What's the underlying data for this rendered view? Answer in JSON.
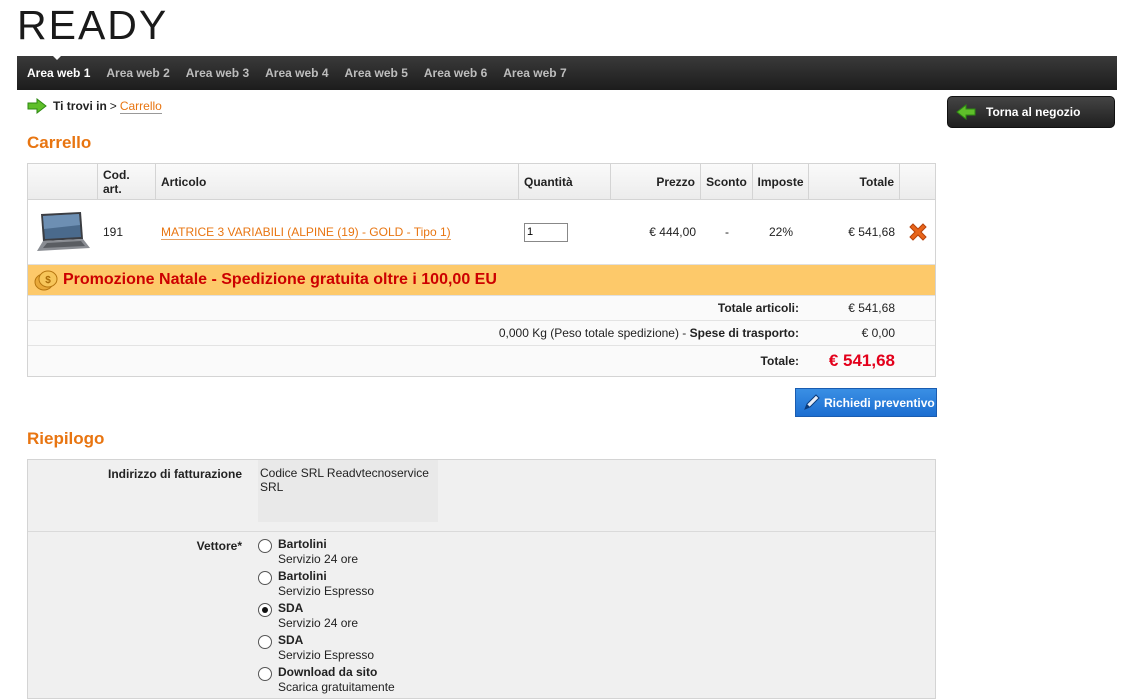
{
  "brand": {
    "logo": "READY"
  },
  "nav": {
    "items": [
      "Area web 1",
      "Area web 2",
      "Area web 3",
      "Area web 4",
      "Area web 5",
      "Area web 6",
      "Area web 7"
    ],
    "active": 0
  },
  "breadcrumb": {
    "prefix": "Ti trovi in",
    "separator": ">",
    "current": "Carrello"
  },
  "back_button": {
    "label": "Torna al negozio"
  },
  "cart": {
    "title": "Carrello",
    "headers": {
      "cod": "Cod. art.",
      "articolo": "Articolo",
      "quantita": "Quantità",
      "prezzo": "Prezzo",
      "sconto": "Sconto",
      "imposte": "Imposte",
      "totale": "Totale"
    },
    "item": {
      "cod": "191",
      "name": "MATRICE 3 VARIABILI (ALPINE (19) - GOLD - Tipo 1)",
      "qty": "1",
      "price": "€ 444,00",
      "discount": "-",
      "tax": "22%",
      "total": "€ 541,68"
    },
    "promo": "Promozione Natale - Spedizione gratuita oltre i 100,00 EU",
    "totale_articoli_label": "Totale articoli:",
    "totale_articoli": "€ 541,68",
    "peso": "0,000 Kg (Peso totale spedizione) -",
    "spese_label": "Spese di trasporto:",
    "spese": "€ 0,00",
    "totale_label": "Totale:",
    "totale": "€ 541,68"
  },
  "quote_button": {
    "label": "Richiedi preventivo"
  },
  "riepilogo": {
    "title": "Riepilogo",
    "billing_label": "Indirizzo di fatturazione",
    "billing_value": "Codice SRL Readvtecnoservice SRL",
    "carrier_label": "Vettore*",
    "carriers": [
      {
        "name": "Bartolini",
        "desc": "Servizio 24 ore",
        "selected": false
      },
      {
        "name": "Bartolini",
        "desc": "Servizio Espresso",
        "selected": false
      },
      {
        "name": "SDA",
        "desc": "Servizio 24 ore",
        "selected": true
      },
      {
        "name": "SDA",
        "desc": "Servizio Espresso",
        "selected": false
      },
      {
        "name": "Download da sito",
        "desc": "Scarica gratuitamente",
        "selected": false
      }
    ]
  },
  "colors": {
    "accent": "#e87511",
    "total_red": "#e3001b",
    "promo_bg": "#fdc96a",
    "nav_bg": "#2a2a2a"
  }
}
